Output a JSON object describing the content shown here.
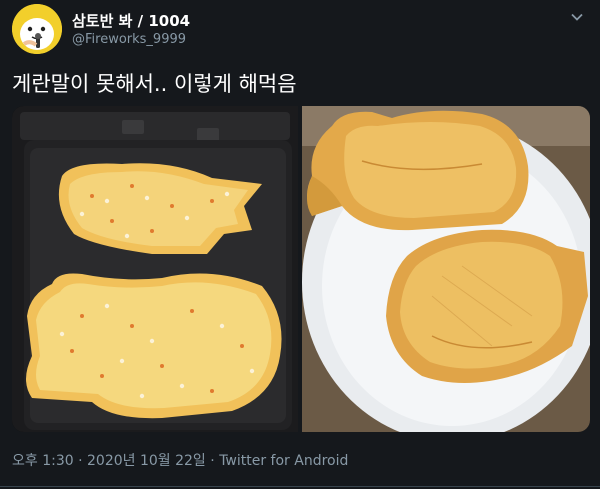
{
  "tweet": {
    "display_name": "삼토반 봐 / 1004",
    "handle": "@Fireworks_9999",
    "text": "게란말이 못해서.. 이렇게 해먹음",
    "time": "오후 1:30",
    "separator": "·",
    "date": "2020년 10월 22일",
    "client": "Twitter for Android"
  },
  "icons": {
    "avatar": "avatar-cartoon-icon",
    "more": "chevron-down-icon"
  },
  "colors": {
    "background": "#15181c",
    "secondary_text": "#8899a6",
    "avatar_bg": "#f2cf2b",
    "divider": "#38444d"
  }
}
